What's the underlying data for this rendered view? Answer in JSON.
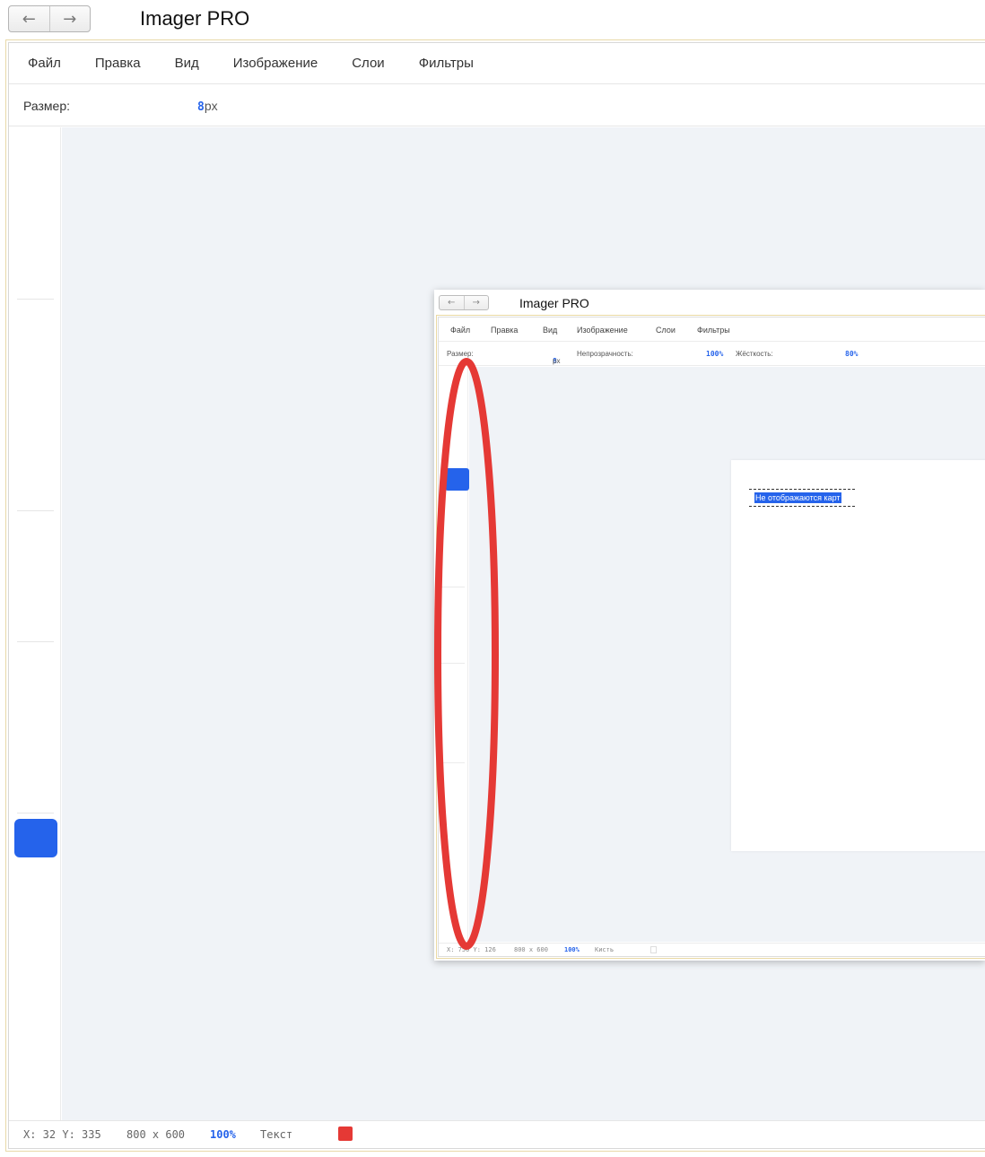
{
  "nav": {
    "back_icon": "←",
    "forward_icon": "→"
  },
  "app": {
    "title": "Imager PRO"
  },
  "menu": [
    "Файл",
    "Правка",
    "Вид",
    "Изображение",
    "Слои",
    "Фильтры"
  ],
  "properties": {
    "size_label": "Размер:",
    "size_value": "8",
    "size_unit": "px"
  },
  "status": {
    "coords": "X: 32 Y: 335",
    "canvas_size": "800 x 600",
    "zoom": "100%",
    "tool": "Текст",
    "color": "#e53935"
  },
  "accent_color": "#2563eb",
  "nested_screenshot": {
    "title": "Imager PRO",
    "menu": [
      "Файл",
      "Правка",
      "Вид",
      "Изображение",
      "Слои",
      "Фильтры"
    ],
    "properties": {
      "size_label": "Размер:",
      "size_value": "8",
      "size_unit": "px",
      "opacity_label": "Непрозрачность:",
      "opacity_value": "100%",
      "hardness_label": "Жёсткость:",
      "hardness_value": "80%"
    },
    "canvas_text": "Не отображаются карт",
    "status": {
      "coords": "X: 750 Y: 126",
      "canvas_size": "800 x 600",
      "zoom": "100%",
      "tool": "Кисть"
    },
    "annotation_color": "#e53935"
  }
}
